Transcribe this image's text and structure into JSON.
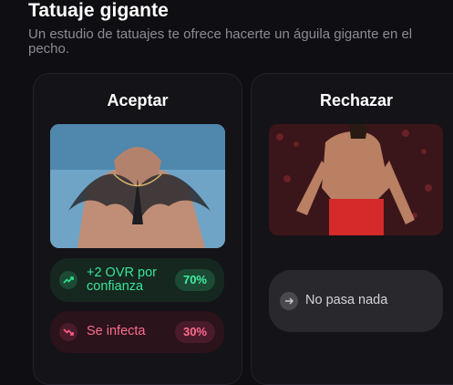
{
  "header": {
    "title": "Tatuaje gigante",
    "subtitle": "Un estudio de tatuajes te ofrece hacerte un águila gigante en el pecho."
  },
  "options": [
    {
      "title": "Aceptar",
      "outcomes": [
        {
          "label": "+2 OVR por confianza",
          "percent": "70%",
          "icon": "trending-up-icon",
          "color": "#38e59a"
        },
        {
          "label": "Se infecta",
          "percent": "30%",
          "icon": "trending-down-icon",
          "color": "#ff6b8f"
        }
      ]
    },
    {
      "title": "Rechazar",
      "outcomes": [
        {
          "label": "No pasa nada",
          "icon": "arrow-right-icon",
          "color": "#d4d3d8"
        }
      ]
    }
  ]
}
